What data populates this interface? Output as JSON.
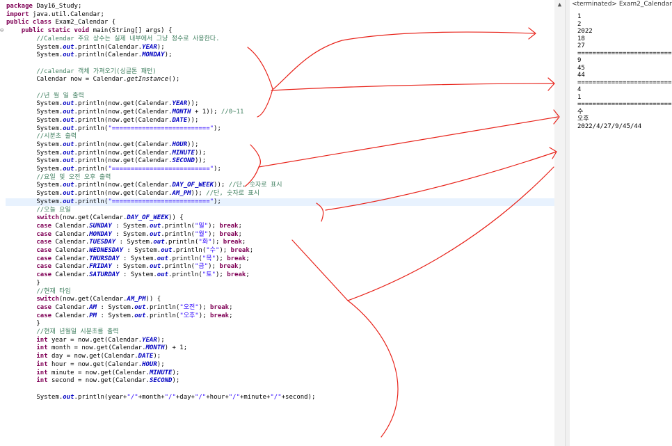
{
  "editor": {
    "lines": [
      [
        {
          "t": "package",
          "c": "kw"
        },
        {
          "t": " Day16_Study;",
          "c": ""
        }
      ],
      [
        {
          "t": "import",
          "c": "kw"
        },
        {
          "t": " java.util.Calendar;",
          "c": ""
        }
      ],
      [
        {
          "t": "public class",
          "c": "kw"
        },
        {
          "t": " Exam2_Calendar {",
          "c": ""
        }
      ],
      [
        {
          "t": "    ",
          "c": ""
        },
        {
          "t": "public static void",
          "c": "kw"
        },
        {
          "t": " main(String[] args) {",
          "c": ""
        }
      ],
      [
        {
          "t": "        //Calendar 주요 상수는 실제 내부에서 그냥 정수로 사용한다.",
          "c": "cm"
        }
      ],
      [
        {
          "t": "        System.",
          "c": ""
        },
        {
          "t": "out",
          "c": "fs"
        },
        {
          "t": ".println(Calendar.",
          "c": ""
        },
        {
          "t": "YEAR",
          "c": "fs"
        },
        {
          "t": ");",
          "c": ""
        }
      ],
      [
        {
          "t": "        System.",
          "c": ""
        },
        {
          "t": "out",
          "c": "fs"
        },
        {
          "t": ".println(Calendar.",
          "c": ""
        },
        {
          "t": "MONDAY",
          "c": "fs"
        },
        {
          "t": ");",
          "c": ""
        }
      ],
      [],
      [
        {
          "t": "        //calendar 객체 가져오기(싱글톤 패턴)",
          "c": "cm"
        }
      ],
      [
        {
          "t": "        Calendar now = Calendar.",
          "c": ""
        },
        {
          "t": "getInstance",
          "c": "sm"
        },
        {
          "t": "();",
          "c": ""
        }
      ],
      [],
      [
        {
          "t": "        //년 월 일 출력",
          "c": "cm"
        }
      ],
      [
        {
          "t": "        System.",
          "c": ""
        },
        {
          "t": "out",
          "c": "fs"
        },
        {
          "t": ".println(now.get(Calendar.",
          "c": ""
        },
        {
          "t": "YEAR",
          "c": "fs"
        },
        {
          "t": "));",
          "c": ""
        }
      ],
      [
        {
          "t": "        System.",
          "c": ""
        },
        {
          "t": "out",
          "c": "fs"
        },
        {
          "t": ".println(now.get(Calendar.",
          "c": ""
        },
        {
          "t": "MONTH",
          "c": "fs"
        },
        {
          "t": " + 1)); ",
          "c": ""
        },
        {
          "t": "//0~11",
          "c": "cm"
        }
      ],
      [
        {
          "t": "        System.",
          "c": ""
        },
        {
          "t": "out",
          "c": "fs"
        },
        {
          "t": ".println(now.get(Calendar.",
          "c": ""
        },
        {
          "t": "DATE",
          "c": "fs"
        },
        {
          "t": "));",
          "c": ""
        }
      ],
      [
        {
          "t": "        System.",
          "c": ""
        },
        {
          "t": "out",
          "c": "fs"
        },
        {
          "t": ".println(",
          "c": ""
        },
        {
          "t": "\"==========================\"",
          "c": "st"
        },
        {
          "t": ");",
          "c": ""
        }
      ],
      [
        {
          "t": "        //시분초 출력",
          "c": "cm"
        }
      ],
      [
        {
          "t": "        System.",
          "c": ""
        },
        {
          "t": "out",
          "c": "fs"
        },
        {
          "t": ".println(now.get(Calendar.",
          "c": ""
        },
        {
          "t": "HOUR",
          "c": "fs"
        },
        {
          "t": "));",
          "c": ""
        }
      ],
      [
        {
          "t": "        System.",
          "c": ""
        },
        {
          "t": "out",
          "c": "fs"
        },
        {
          "t": ".println(now.get(Calendar.",
          "c": ""
        },
        {
          "t": "MINUTE",
          "c": "fs"
        },
        {
          "t": "));",
          "c": ""
        }
      ],
      [
        {
          "t": "        System.",
          "c": ""
        },
        {
          "t": "out",
          "c": "fs"
        },
        {
          "t": ".println(now.get(Calendar.",
          "c": ""
        },
        {
          "t": "SECOND",
          "c": "fs"
        },
        {
          "t": "));",
          "c": ""
        }
      ],
      [
        {
          "t": "        System.",
          "c": ""
        },
        {
          "t": "out",
          "c": "fs"
        },
        {
          "t": ".println(",
          "c": ""
        },
        {
          "t": "\"==========================\"",
          "c": "st"
        },
        {
          "t": ");",
          "c": ""
        }
      ],
      [
        {
          "t": "        //요일 및 오전 오후 출력",
          "c": "cm"
        }
      ],
      [
        {
          "t": "        System.",
          "c": ""
        },
        {
          "t": "out",
          "c": "fs"
        },
        {
          "t": ".println(now.get(Calendar.",
          "c": ""
        },
        {
          "t": "DAY_OF_WEEK",
          "c": "fs"
        },
        {
          "t": ")); ",
          "c": ""
        },
        {
          "t": "//단, 숫자로 표시",
          "c": "cm"
        }
      ],
      [
        {
          "t": "        System.",
          "c": ""
        },
        {
          "t": "out",
          "c": "fs"
        },
        {
          "t": ".println(now.get(Calendar.",
          "c": ""
        },
        {
          "t": "AM_PM",
          "c": "fs"
        },
        {
          "t": ")); ",
          "c": ""
        },
        {
          "t": "//단, 숫자로 표시",
          "c": "cm"
        }
      ],
      [
        {
          "t": "        System.",
          "c": ""
        },
        {
          "t": "out",
          "c": "fs"
        },
        {
          "t": ".println(",
          "c": ""
        },
        {
          "t": "\"==========================\"",
          "c": "st"
        },
        {
          "t": ");",
          "c": ""
        }
      ],
      [
        {
          "t": "        //오늘 요일",
          "c": "cm"
        }
      ],
      [
        {
          "t": "        ",
          "c": ""
        },
        {
          "t": "switch",
          "c": "kw"
        },
        {
          "t": "(now.get(Calendar.",
          "c": ""
        },
        {
          "t": "DAY_OF_WEEK",
          "c": "fs"
        },
        {
          "t": ")) {",
          "c": ""
        }
      ],
      [
        {
          "t": "        ",
          "c": ""
        },
        {
          "t": "case",
          "c": "kw"
        },
        {
          "t": " Calendar.",
          "c": ""
        },
        {
          "t": "SUNDAY",
          "c": "fs"
        },
        {
          "t": " : System.",
          "c": ""
        },
        {
          "t": "out",
          "c": "fs"
        },
        {
          "t": ".println(",
          "c": ""
        },
        {
          "t": "\"일\"",
          "c": "st"
        },
        {
          "t": "); ",
          "c": ""
        },
        {
          "t": "break",
          "c": "kw"
        },
        {
          "t": ";",
          "c": ""
        }
      ],
      [
        {
          "t": "        ",
          "c": ""
        },
        {
          "t": "case",
          "c": "kw"
        },
        {
          "t": " Calendar.",
          "c": ""
        },
        {
          "t": "MONDAY",
          "c": "fs"
        },
        {
          "t": " : System.",
          "c": ""
        },
        {
          "t": "out",
          "c": "fs"
        },
        {
          "t": ".println(",
          "c": ""
        },
        {
          "t": "\"월\"",
          "c": "st"
        },
        {
          "t": "); ",
          "c": ""
        },
        {
          "t": "break",
          "c": "kw"
        },
        {
          "t": ";",
          "c": ""
        }
      ],
      [
        {
          "t": "        ",
          "c": ""
        },
        {
          "t": "case",
          "c": "kw"
        },
        {
          "t": " Calendar.",
          "c": ""
        },
        {
          "t": "TUESDAY",
          "c": "fs"
        },
        {
          "t": " : System.",
          "c": ""
        },
        {
          "t": "out",
          "c": "fs"
        },
        {
          "t": ".println(",
          "c": ""
        },
        {
          "t": "\"화\"",
          "c": "st"
        },
        {
          "t": "); ",
          "c": ""
        },
        {
          "t": "break",
          "c": "kw"
        },
        {
          "t": ";",
          "c": ""
        }
      ],
      [
        {
          "t": "        ",
          "c": ""
        },
        {
          "t": "case",
          "c": "kw"
        },
        {
          "t": " Calendar.",
          "c": ""
        },
        {
          "t": "WEDNESDAY",
          "c": "fs"
        },
        {
          "t": " : System.",
          "c": ""
        },
        {
          "t": "out",
          "c": "fs"
        },
        {
          "t": ".println(",
          "c": ""
        },
        {
          "t": "\"수\"",
          "c": "st"
        },
        {
          "t": "); ",
          "c": ""
        },
        {
          "t": "break",
          "c": "kw"
        },
        {
          "t": ";",
          "c": ""
        }
      ],
      [
        {
          "t": "        ",
          "c": ""
        },
        {
          "t": "case",
          "c": "kw"
        },
        {
          "t": " Calendar.",
          "c": ""
        },
        {
          "t": "THURSDAY",
          "c": "fs"
        },
        {
          "t": " : System.",
          "c": ""
        },
        {
          "t": "out",
          "c": "fs"
        },
        {
          "t": ".println(",
          "c": ""
        },
        {
          "t": "\"목\"",
          "c": "st"
        },
        {
          "t": "); ",
          "c": ""
        },
        {
          "t": "break",
          "c": "kw"
        },
        {
          "t": ";",
          "c": ""
        }
      ],
      [
        {
          "t": "        ",
          "c": ""
        },
        {
          "t": "case",
          "c": "kw"
        },
        {
          "t": " Calendar.",
          "c": ""
        },
        {
          "t": "FRIDAY",
          "c": "fs"
        },
        {
          "t": " : System.",
          "c": ""
        },
        {
          "t": "out",
          "c": "fs"
        },
        {
          "t": ".println(",
          "c": ""
        },
        {
          "t": "\"금\"",
          "c": "st"
        },
        {
          "t": "); ",
          "c": ""
        },
        {
          "t": "break",
          "c": "kw"
        },
        {
          "t": ";",
          "c": ""
        }
      ],
      [
        {
          "t": "        ",
          "c": ""
        },
        {
          "t": "case",
          "c": "kw"
        },
        {
          "t": " Calendar.",
          "c": ""
        },
        {
          "t": "SATURDAY",
          "c": "fs"
        },
        {
          "t": " : System.",
          "c": ""
        },
        {
          "t": "out",
          "c": "fs"
        },
        {
          "t": ".println(",
          "c": ""
        },
        {
          "t": "\"토\"",
          "c": "st"
        },
        {
          "t": "); ",
          "c": ""
        },
        {
          "t": "break",
          "c": "kw"
        },
        {
          "t": ";",
          "c": ""
        }
      ],
      [
        {
          "t": "        }",
          "c": ""
        }
      ],
      [
        {
          "t": "        //현재 타임",
          "c": "cm"
        }
      ],
      [
        {
          "t": "        ",
          "c": ""
        },
        {
          "t": "switch",
          "c": "kw"
        },
        {
          "t": "(now.get(Calendar.",
          "c": ""
        },
        {
          "t": "AM_PM",
          "c": "fs"
        },
        {
          "t": ")) {",
          "c": ""
        }
      ],
      [
        {
          "t": "        ",
          "c": ""
        },
        {
          "t": "case",
          "c": "kw"
        },
        {
          "t": " Calendar.",
          "c": ""
        },
        {
          "t": "AM",
          "c": "fs"
        },
        {
          "t": " : System.",
          "c": ""
        },
        {
          "t": "out",
          "c": "fs"
        },
        {
          "t": ".println(",
          "c": ""
        },
        {
          "t": "\"오전\"",
          "c": "st"
        },
        {
          "t": "); ",
          "c": ""
        },
        {
          "t": "break",
          "c": "kw"
        },
        {
          "t": ";",
          "c": ""
        }
      ],
      [
        {
          "t": "        ",
          "c": ""
        },
        {
          "t": "case",
          "c": "kw"
        },
        {
          "t": " Calendar.",
          "c": ""
        },
        {
          "t": "PM",
          "c": "fs"
        },
        {
          "t": " : System.",
          "c": ""
        },
        {
          "t": "out",
          "c": "fs"
        },
        {
          "t": ".println(",
          "c": ""
        },
        {
          "t": "\"오후\"",
          "c": "st"
        },
        {
          "t": "); ",
          "c": ""
        },
        {
          "t": "break",
          "c": "kw"
        },
        {
          "t": ";",
          "c": ""
        }
      ],
      [
        {
          "t": "        }",
          "c": ""
        }
      ],
      [
        {
          "t": "        //현재 년월일 시분초를 출력",
          "c": "cm"
        }
      ],
      [
        {
          "t": "        ",
          "c": ""
        },
        {
          "t": "int",
          "c": "kw"
        },
        {
          "t": " year = now.get(Calendar.",
          "c": ""
        },
        {
          "t": "YEAR",
          "c": "fs"
        },
        {
          "t": ");",
          "c": ""
        }
      ],
      [
        {
          "t": "        ",
          "c": ""
        },
        {
          "t": "int",
          "c": "kw"
        },
        {
          "t": " month = now.get(Calendar.",
          "c": ""
        },
        {
          "t": "MONTH",
          "c": "fs"
        },
        {
          "t": ") + 1;",
          "c": ""
        }
      ],
      [
        {
          "t": "        ",
          "c": ""
        },
        {
          "t": "int",
          "c": "kw"
        },
        {
          "t": " day = now.get(Calendar.",
          "c": ""
        },
        {
          "t": "DATE",
          "c": "fs"
        },
        {
          "t": ");",
          "c": ""
        }
      ],
      [
        {
          "t": "        ",
          "c": ""
        },
        {
          "t": "int",
          "c": "kw"
        },
        {
          "t": " hour = now.get(Calendar.",
          "c": ""
        },
        {
          "t": "HOUR",
          "c": "fs"
        },
        {
          "t": ");",
          "c": ""
        }
      ],
      [
        {
          "t": "        ",
          "c": ""
        },
        {
          "t": "int",
          "c": "kw"
        },
        {
          "t": " minute = now.get(Calendar.",
          "c": ""
        },
        {
          "t": "MINUTE",
          "c": "fs"
        },
        {
          "t": ");",
          "c": ""
        }
      ],
      [
        {
          "t": "        ",
          "c": ""
        },
        {
          "t": "int",
          "c": "kw"
        },
        {
          "t": " second = now.get(Calendar.",
          "c": ""
        },
        {
          "t": "SECOND",
          "c": "fs"
        },
        {
          "t": ");",
          "c": ""
        }
      ],
      [],
      [
        {
          "t": "        System.",
          "c": ""
        },
        {
          "t": "out",
          "c": "fs"
        },
        {
          "t": ".println(year+",
          "c": ""
        },
        {
          "t": "\"/\"",
          "c": "st"
        },
        {
          "t": "+month+",
          "c": ""
        },
        {
          "t": "\"/\"",
          "c": "st"
        },
        {
          "t": "+day+",
          "c": ""
        },
        {
          "t": "\"/\"",
          "c": "st"
        },
        {
          "t": "+hour+",
          "c": ""
        },
        {
          "t": "\"/\"",
          "c": "st"
        },
        {
          "t": "+minute+",
          "c": ""
        },
        {
          "t": "\"/\"",
          "c": "st"
        },
        {
          "t": "+second);",
          "c": ""
        }
      ]
    ],
    "highlighted_line": 24,
    "fold_marker": "⊖",
    "scroll_up_glyph": "▲"
  },
  "console": {
    "header": "<terminated> Exam2_Calendar",
    "lines": [
      "1",
      "2",
      "2022",
      "18",
      "27",
      "==========================",
      "9",
      "45",
      "44",
      "==========================",
      "4",
      "1",
      "==========================",
      "수",
      "오후",
      "2022/4/27/9/45/44"
    ]
  },
  "colors": {
    "keyword": "#7f0055",
    "comment": "#3f7f5f",
    "string": "#2a00ff",
    "static_field": "#0000c0",
    "annotation_pen": "#e8231a",
    "highlight": "#e8f2fe"
  }
}
